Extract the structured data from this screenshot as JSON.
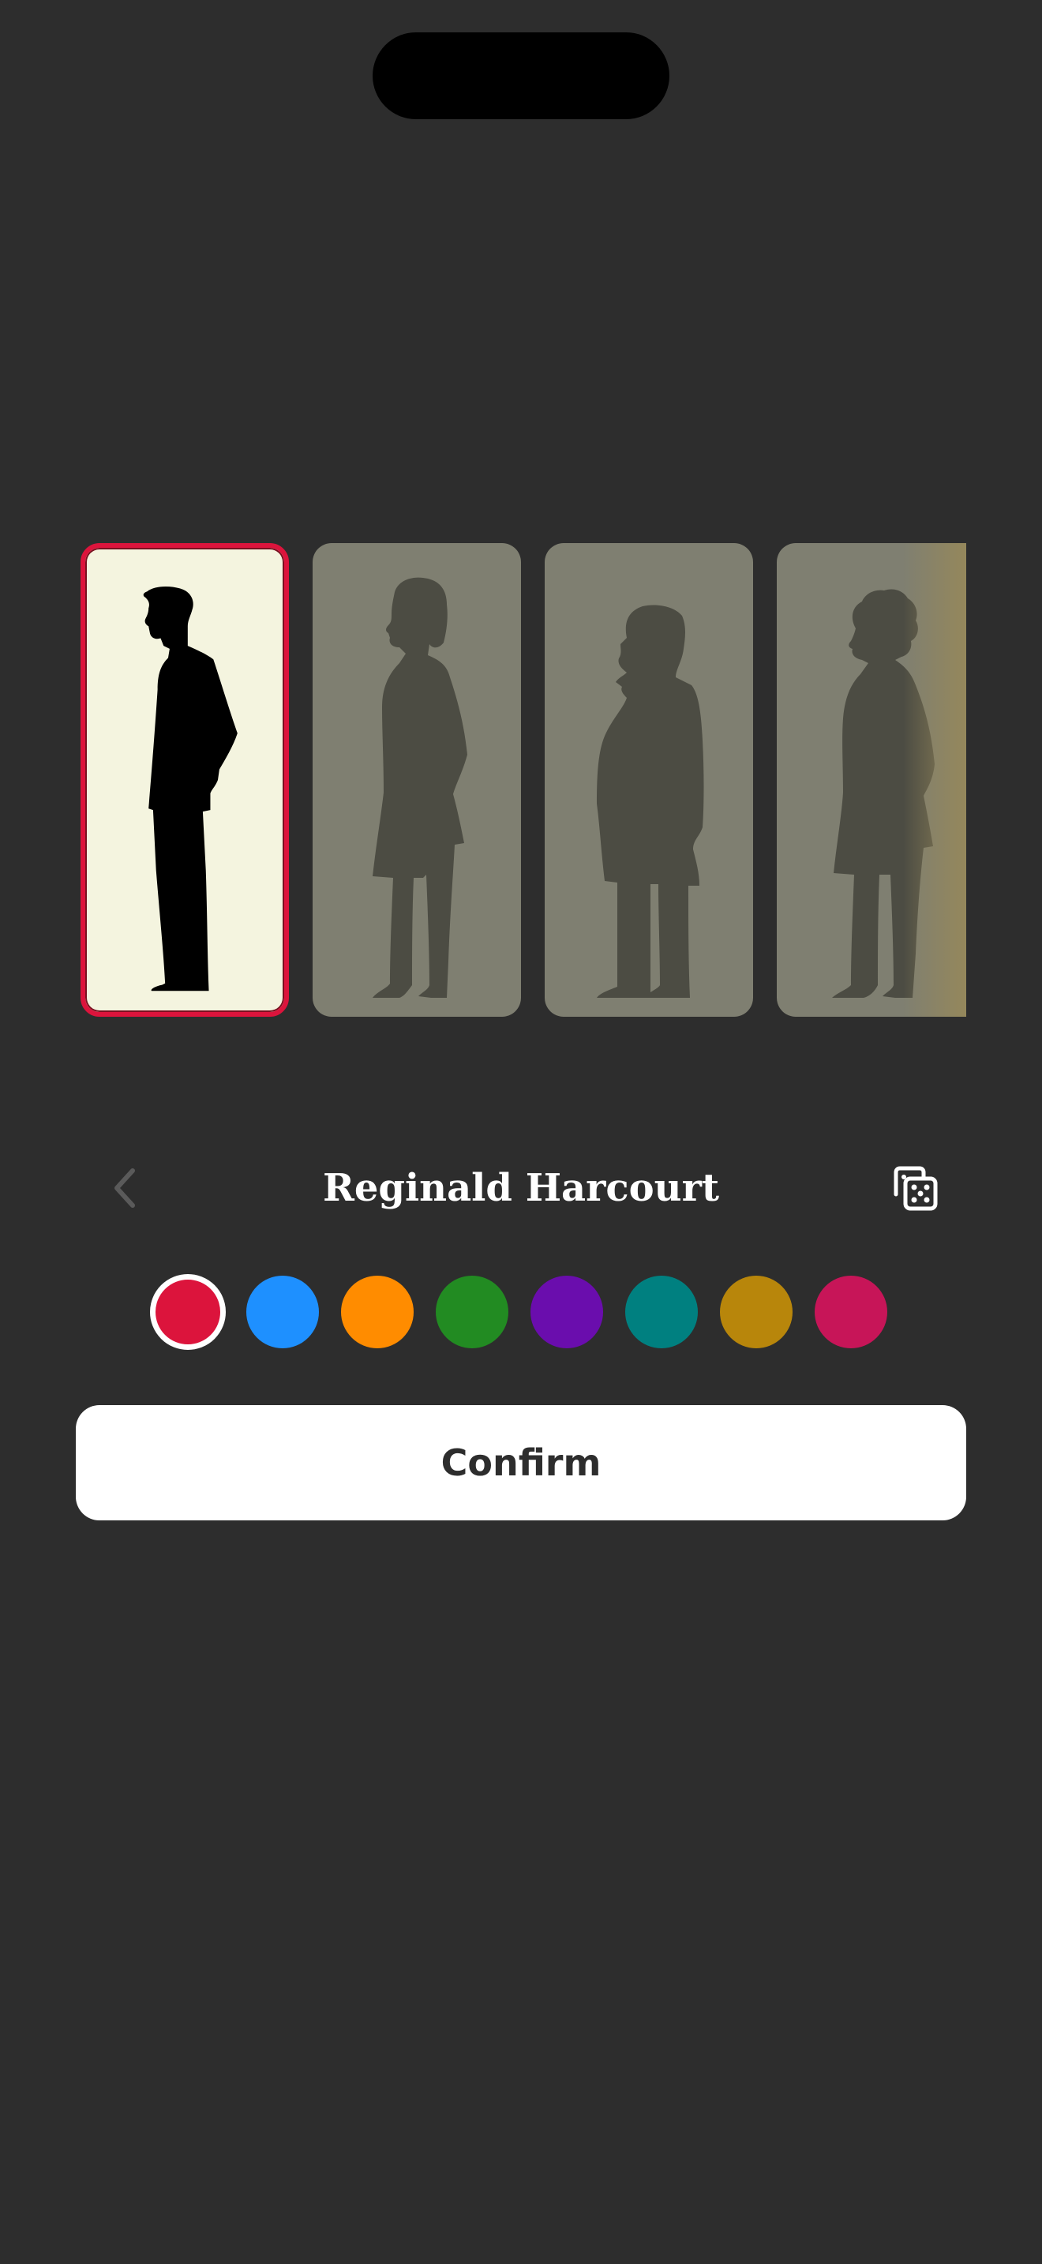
{
  "character": {
    "name": "Reginald Harcourt"
  },
  "colors": {
    "selected_border": "#dc143c",
    "card_selected_bg": "#f4f4df",
    "card_bg": "#7f7f71",
    "silhouette_selected": "#000000",
    "silhouette_dim": "#4c4c43"
  },
  "silhouettes": [
    {
      "icon": "man-tall-silhouette-icon",
      "selected": true
    },
    {
      "icon": "woman-bob-silhouette-icon",
      "selected": false
    },
    {
      "icon": "man-stout-silhouette-icon",
      "selected": false
    },
    {
      "icon": "woman-curly-silhouette-icon",
      "selected": false
    }
  ],
  "swatches": [
    {
      "color": "#dc143c",
      "selected": true
    },
    {
      "color": "#1e90ff",
      "selected": false
    },
    {
      "color": "#ff8c00",
      "selected": false
    },
    {
      "color": "#228b22",
      "selected": false
    },
    {
      "color": "#6a0dad",
      "selected": false
    },
    {
      "color": "#008080",
      "selected": false
    },
    {
      "color": "#b8860b",
      "selected": false
    },
    {
      "color": "#c71558",
      "selected": false
    }
  ],
  "buttons": {
    "confirm_label": "Confirm"
  },
  "icons": {
    "back": "chevron-left-icon",
    "randomize": "dice-icon"
  }
}
